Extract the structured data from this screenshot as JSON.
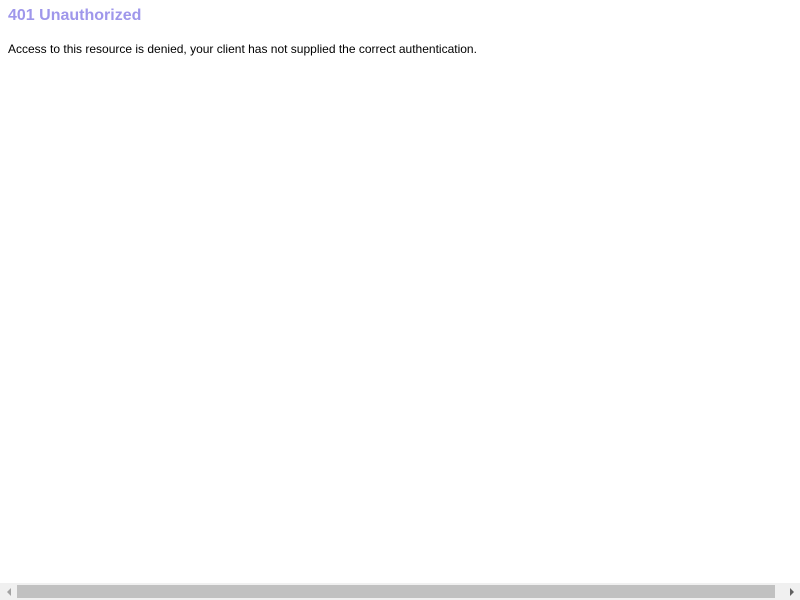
{
  "error": {
    "title": "401 Unauthorized",
    "message": "Access to this resource is denied, your client has not supplied the correct authentication."
  },
  "colors": {
    "title": "#9f97eb",
    "text": "#000000",
    "background": "#ffffff"
  },
  "scrollbar": {
    "left_icon": "scroll-left-icon",
    "right_icon": "scroll-right-icon"
  }
}
